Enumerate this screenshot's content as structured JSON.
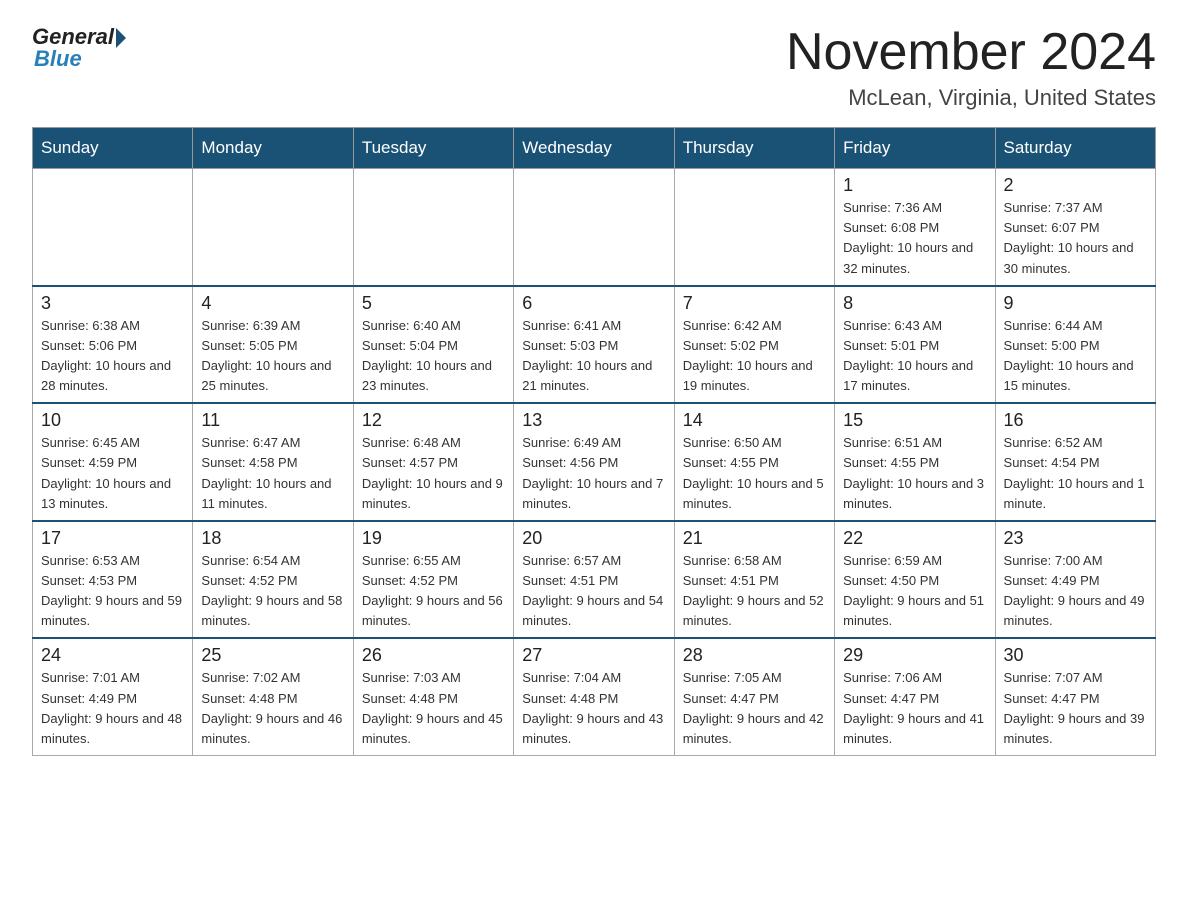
{
  "header": {
    "logo_general": "General",
    "logo_blue": "Blue",
    "month_title": "November 2024",
    "location": "McLean, Virginia, United States"
  },
  "weekdays": [
    "Sunday",
    "Monday",
    "Tuesday",
    "Wednesday",
    "Thursday",
    "Friday",
    "Saturday"
  ],
  "weeks": [
    [
      {
        "day": "",
        "info": ""
      },
      {
        "day": "",
        "info": ""
      },
      {
        "day": "",
        "info": ""
      },
      {
        "day": "",
        "info": ""
      },
      {
        "day": "",
        "info": ""
      },
      {
        "day": "1",
        "info": "Sunrise: 7:36 AM\nSunset: 6:08 PM\nDaylight: 10 hours\nand 32 minutes."
      },
      {
        "day": "2",
        "info": "Sunrise: 7:37 AM\nSunset: 6:07 PM\nDaylight: 10 hours\nand 30 minutes."
      }
    ],
    [
      {
        "day": "3",
        "info": "Sunrise: 6:38 AM\nSunset: 5:06 PM\nDaylight: 10 hours\nand 28 minutes."
      },
      {
        "day": "4",
        "info": "Sunrise: 6:39 AM\nSunset: 5:05 PM\nDaylight: 10 hours\nand 25 minutes."
      },
      {
        "day": "5",
        "info": "Sunrise: 6:40 AM\nSunset: 5:04 PM\nDaylight: 10 hours\nand 23 minutes."
      },
      {
        "day": "6",
        "info": "Sunrise: 6:41 AM\nSunset: 5:03 PM\nDaylight: 10 hours\nand 21 minutes."
      },
      {
        "day": "7",
        "info": "Sunrise: 6:42 AM\nSunset: 5:02 PM\nDaylight: 10 hours\nand 19 minutes."
      },
      {
        "day": "8",
        "info": "Sunrise: 6:43 AM\nSunset: 5:01 PM\nDaylight: 10 hours\nand 17 minutes."
      },
      {
        "day": "9",
        "info": "Sunrise: 6:44 AM\nSunset: 5:00 PM\nDaylight: 10 hours\nand 15 minutes."
      }
    ],
    [
      {
        "day": "10",
        "info": "Sunrise: 6:45 AM\nSunset: 4:59 PM\nDaylight: 10 hours\nand 13 minutes."
      },
      {
        "day": "11",
        "info": "Sunrise: 6:47 AM\nSunset: 4:58 PM\nDaylight: 10 hours\nand 11 minutes."
      },
      {
        "day": "12",
        "info": "Sunrise: 6:48 AM\nSunset: 4:57 PM\nDaylight: 10 hours\nand 9 minutes."
      },
      {
        "day": "13",
        "info": "Sunrise: 6:49 AM\nSunset: 4:56 PM\nDaylight: 10 hours\nand 7 minutes."
      },
      {
        "day": "14",
        "info": "Sunrise: 6:50 AM\nSunset: 4:55 PM\nDaylight: 10 hours\nand 5 minutes."
      },
      {
        "day": "15",
        "info": "Sunrise: 6:51 AM\nSunset: 4:55 PM\nDaylight: 10 hours\nand 3 minutes."
      },
      {
        "day": "16",
        "info": "Sunrise: 6:52 AM\nSunset: 4:54 PM\nDaylight: 10 hours\nand 1 minute."
      }
    ],
    [
      {
        "day": "17",
        "info": "Sunrise: 6:53 AM\nSunset: 4:53 PM\nDaylight: 9 hours\nand 59 minutes."
      },
      {
        "day": "18",
        "info": "Sunrise: 6:54 AM\nSunset: 4:52 PM\nDaylight: 9 hours\nand 58 minutes."
      },
      {
        "day": "19",
        "info": "Sunrise: 6:55 AM\nSunset: 4:52 PM\nDaylight: 9 hours\nand 56 minutes."
      },
      {
        "day": "20",
        "info": "Sunrise: 6:57 AM\nSunset: 4:51 PM\nDaylight: 9 hours\nand 54 minutes."
      },
      {
        "day": "21",
        "info": "Sunrise: 6:58 AM\nSunset: 4:51 PM\nDaylight: 9 hours\nand 52 minutes."
      },
      {
        "day": "22",
        "info": "Sunrise: 6:59 AM\nSunset: 4:50 PM\nDaylight: 9 hours\nand 51 minutes."
      },
      {
        "day": "23",
        "info": "Sunrise: 7:00 AM\nSunset: 4:49 PM\nDaylight: 9 hours\nand 49 minutes."
      }
    ],
    [
      {
        "day": "24",
        "info": "Sunrise: 7:01 AM\nSunset: 4:49 PM\nDaylight: 9 hours\nand 48 minutes."
      },
      {
        "day": "25",
        "info": "Sunrise: 7:02 AM\nSunset: 4:48 PM\nDaylight: 9 hours\nand 46 minutes."
      },
      {
        "day": "26",
        "info": "Sunrise: 7:03 AM\nSunset: 4:48 PM\nDaylight: 9 hours\nand 45 minutes."
      },
      {
        "day": "27",
        "info": "Sunrise: 7:04 AM\nSunset: 4:48 PM\nDaylight: 9 hours\nand 43 minutes."
      },
      {
        "day": "28",
        "info": "Sunrise: 7:05 AM\nSunset: 4:47 PM\nDaylight: 9 hours\nand 42 minutes."
      },
      {
        "day": "29",
        "info": "Sunrise: 7:06 AM\nSunset: 4:47 PM\nDaylight: 9 hours\nand 41 minutes."
      },
      {
        "day": "30",
        "info": "Sunrise: 7:07 AM\nSunset: 4:47 PM\nDaylight: 9 hours\nand 39 minutes."
      }
    ]
  ]
}
